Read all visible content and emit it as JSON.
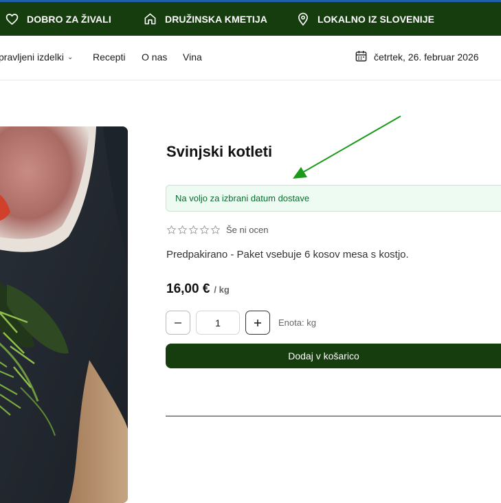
{
  "topbar": {
    "items": [
      {
        "label": "DOBRO ZA ŽIVALI",
        "icon": "heart-icon"
      },
      {
        "label": "DRUŽINSKA KMETIJA",
        "icon": "home-icon"
      },
      {
        "label": "LOKALNO IZ SLOVENIJE",
        "icon": "location-pin-icon"
      }
    ],
    "background": "#163d0e",
    "accent_line": "#1f5fae"
  },
  "nav": {
    "items": [
      {
        "label": "pravljeni izdelki",
        "has_dropdown": true
      },
      {
        "label": "Recepti"
      },
      {
        "label": "O nas"
      },
      {
        "label": "Vina"
      }
    ],
    "date": "četrtek, 26. februar 2026",
    "date_icon": "calendar-icon"
  },
  "product": {
    "title": "Svinjski kotleti",
    "availability": "Na voljo za izbrani datum dostave",
    "rating_text": "Še ni ocen",
    "stars_filled": 0,
    "stars_total": 5,
    "description": "Predpakirano - Paket vsebuje 6 kosov mesa s kostjo.",
    "price": "16,00 €",
    "price_unit": "/ kg",
    "quantity": "1",
    "unit_label": "Enota: kg",
    "add_to_cart": "Dodaj v košarico",
    "image_icon": "meat-photo"
  },
  "annotation": {
    "color": "#1a9a1a"
  }
}
